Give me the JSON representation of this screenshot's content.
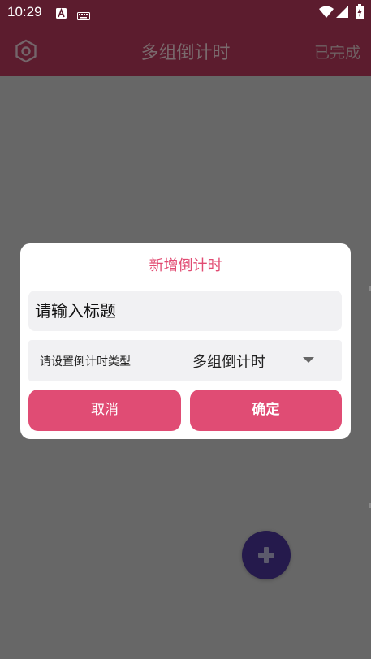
{
  "status_bar": {
    "time": "10:29",
    "icons": [
      "text-a-icon",
      "keyboard-icon",
      "wifi-icon",
      "signal-icon",
      "battery-charging-icon"
    ]
  },
  "app_bar": {
    "title": "多组倒计时",
    "settings_icon": "hexagon-settings-icon",
    "completed_label": "已完成"
  },
  "dialog": {
    "title": "新增倒计时",
    "title_input": {
      "placeholder": "请输入标题",
      "value": ""
    },
    "type_row": {
      "label": "请设置倒计时类型",
      "selected": "多组倒计时"
    },
    "cancel_label": "取消",
    "confirm_label": "确定"
  },
  "fab": {
    "icon": "plus-icon"
  },
  "colors": {
    "app_bar": "#5c1c2e",
    "accent": "#e04c74",
    "dialog_title": "#e14b72",
    "overlay": "#676767",
    "fab": "#251a4c"
  }
}
